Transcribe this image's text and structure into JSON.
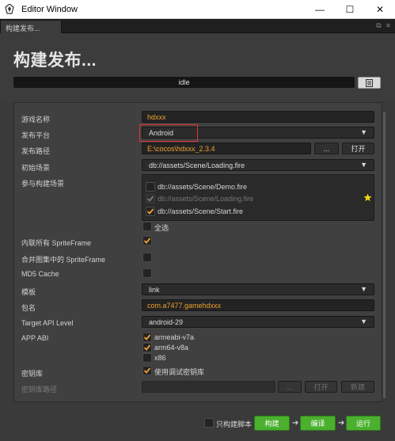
{
  "window": {
    "title": "Editor Window",
    "minimize": "—",
    "maximize": "☐",
    "close": "✕"
  },
  "tab": {
    "label": "构建发布..."
  },
  "header": {
    "title": "构建发布...",
    "status": "idle"
  },
  "form": {
    "game_name": {
      "label": "游戏名称",
      "value": "hdxxx"
    },
    "platform": {
      "label": "发布平台",
      "value": "Android"
    },
    "build_path": {
      "label": "发布路径",
      "value": "E:\\cocos\\hdxxx_2.3.4",
      "browse": "...",
      "open": "打开"
    },
    "start_scene": {
      "label": "初始场景",
      "value": "db://assets/Scene/Loading.fire"
    },
    "scenes": {
      "label": "参与构建场景",
      "items": [
        {
          "path": "db://assets/Scene/Demo.fire",
          "checked": false
        },
        {
          "path": "db://assets/Scene/Loading.fire",
          "checked": true
        },
        {
          "path": "db://assets/Scene/Start.fire",
          "checked": true
        }
      ],
      "select_all": "全选"
    },
    "inline_sprite": {
      "label": "内联所有 SpriteFrame",
      "checked": true
    },
    "merge_sprite": {
      "label": "合并图集中的 SpriteFrame",
      "checked": false
    },
    "md5": {
      "label": "MD5 Cache",
      "checked": false
    },
    "template": {
      "label": "模板",
      "value": "link"
    },
    "package": {
      "label": "包名",
      "value": "com.a7477.gamehdxxx"
    },
    "api_level": {
      "label": "Target API Level",
      "value": "android-29"
    },
    "abi": {
      "label": "APP ABI",
      "options": [
        {
          "name": "armeabi-v7a",
          "checked": true
        },
        {
          "name": "arm64-v8a",
          "checked": true
        },
        {
          "name": "x86",
          "checked": false
        }
      ]
    },
    "keystore": {
      "label": "密钥库",
      "option": "使用调试密钥库",
      "checked": true
    },
    "keystore_path": {
      "label": "密钥库路径",
      "browse": "...",
      "open": "打开",
      "new": "新建"
    }
  },
  "footer": {
    "build_script_only": "只构建脚本",
    "build": "构建",
    "compile": "编译",
    "run": "运行"
  },
  "colors": {
    "accent_green": "#4ab02e",
    "checkbox_orange": "#f0a030",
    "highlight_red": "#e5322f"
  }
}
